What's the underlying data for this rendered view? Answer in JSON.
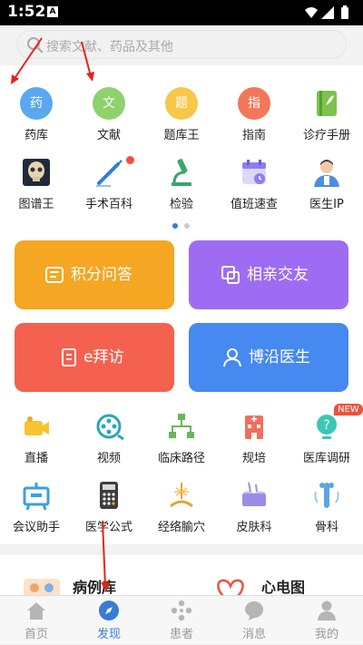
{
  "status_bar": {
    "time": "1:52",
    "notification_icon": "A"
  },
  "search": {
    "placeholder": "搜索文献、药品及其他"
  },
  "grid_row1": [
    {
      "label": "药库",
      "glyph": "药",
      "color": "#5aa8f0",
      "icon": "drug-library-icon"
    },
    {
      "label": "文献",
      "glyph": "文",
      "color": "#8fd16c",
      "icon": "literature-icon"
    },
    {
      "label": "题库王",
      "glyph": "题",
      "color": "#f7c748",
      "icon": "question-bank-icon"
    },
    {
      "label": "指南",
      "glyph": "指",
      "color": "#f3775b",
      "icon": "guideline-icon"
    },
    {
      "label": "诊疗手册",
      "glyph": "",
      "color": "#7cc24b",
      "icon": "handbook-icon"
    }
  ],
  "grid_row2": [
    {
      "label": "图谱王",
      "icon": "atlas-icon"
    },
    {
      "label": "手术百科",
      "icon": "surgery-icon"
    },
    {
      "label": "检验",
      "icon": "microscope-icon"
    },
    {
      "label": "值班速查",
      "icon": "duty-calendar-icon"
    },
    {
      "label": "医生IP",
      "icon": "doctor-icon"
    }
  ],
  "banners": [
    {
      "label": "积分问答",
      "color": "#f5a623",
      "icon": "qa-icon"
    },
    {
      "label": "相亲交友",
      "color": "#9e6cf2",
      "icon": "dating-icon"
    },
    {
      "label": "e拜访",
      "color": "#f5614f",
      "icon": "visit-icon"
    },
    {
      "label": "博沿医生",
      "color": "#4689f0",
      "icon": "doctor-badge-icon"
    }
  ],
  "tools_row1": [
    {
      "label": "直播",
      "icon": "live-camera-icon"
    },
    {
      "label": "视频",
      "icon": "video-reel-icon"
    },
    {
      "label": "临床路径",
      "icon": "pathway-icon"
    },
    {
      "label": "规培",
      "icon": "hospital-icon"
    },
    {
      "label": "医库调研",
      "icon": "survey-icon",
      "badge": "NEW"
    }
  ],
  "tools_row2": [
    {
      "label": "会议助手",
      "icon": "meeting-icon"
    },
    {
      "label": "医学公式",
      "icon": "calculator-icon"
    },
    {
      "label": "经络腧穴",
      "icon": "acupoint-icon"
    },
    {
      "label": "皮肤科",
      "icon": "skin-icon"
    },
    {
      "label": "骨科",
      "icon": "bone-icon"
    }
  ],
  "cards": [
    {
      "label": "病例库",
      "icon": "case-library-icon"
    },
    {
      "label": "心电图",
      "icon": "ecg-icon"
    }
  ],
  "tabs": [
    {
      "label": "首页",
      "icon": "home-icon"
    },
    {
      "label": "发现",
      "icon": "compass-icon",
      "active": true
    },
    {
      "label": "患者",
      "icon": "patients-icon"
    },
    {
      "label": "消息",
      "icon": "message-icon"
    },
    {
      "label": "我的",
      "icon": "profile-icon"
    }
  ],
  "colors": {
    "accent": "#3a7bd5",
    "annotation_arrow": "#e8231b"
  }
}
